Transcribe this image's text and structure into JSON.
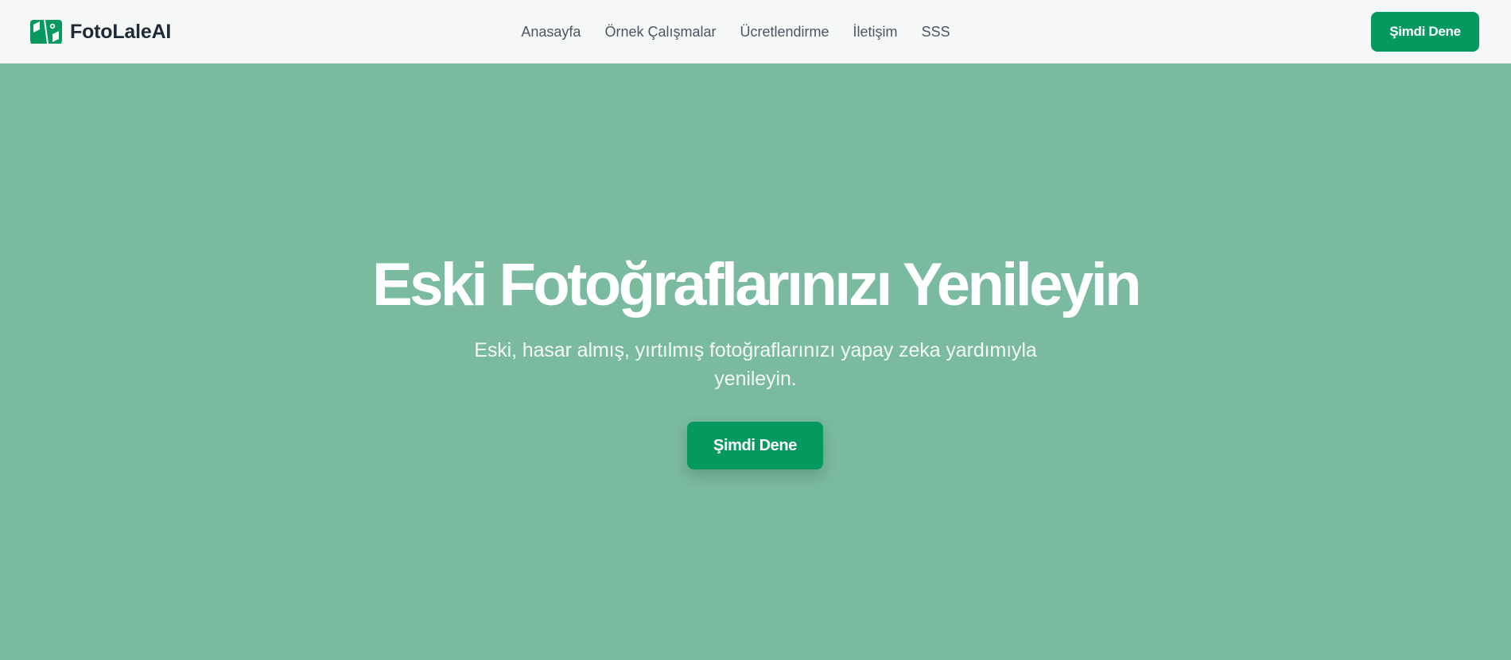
{
  "brand": {
    "name": "FotoLaleAI",
    "logo_icon": "photo-restore-icon",
    "accent_color": "#06995f"
  },
  "nav": {
    "links": [
      {
        "label": "Anasayfa"
      },
      {
        "label": "Örnek Çalışmalar"
      },
      {
        "label": "Ücretlendirme"
      },
      {
        "label": "İletişim"
      },
      {
        "label": "SSS"
      }
    ],
    "cta_label": "Şimdi Dene"
  },
  "hero": {
    "title": "Eski Fotoğraflarınızı Yenileyin",
    "subtitle": "Eski, hasar almış, yırtılmış fotoğraflarınızı yapay zeka yardımıyla yenileyin.",
    "cta_label": "Şimdi Dene",
    "background_color": "#7aba9f"
  }
}
